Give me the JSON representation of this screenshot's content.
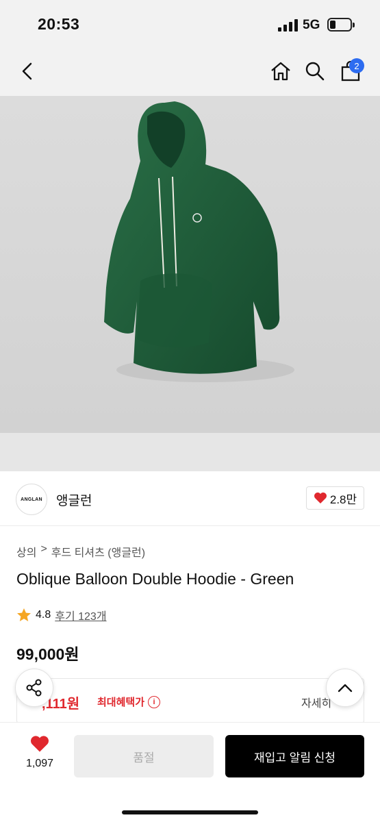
{
  "status_bar": {
    "time": "20:53",
    "network": "5G"
  },
  "nav": {
    "cart_count": "2"
  },
  "brand": {
    "logo_text": "ANGLAN",
    "name": "앵글런",
    "likes": "2.8만"
  },
  "breadcrumb": {
    "category": "상의",
    "separator": ">",
    "subcategory": "후드 티셔츠 (앵글런)"
  },
  "product": {
    "title": "Oblique Balloon Double Hoodie - Green",
    "rating": "4.8",
    "reviews": "후기 123개",
    "price": "99,000원",
    "benefit_price": ",111원",
    "benefit_label": "최대혜택가",
    "benefit_detail": "자세히"
  },
  "bottom": {
    "wish_count": "1,097",
    "soldout_label": "품절",
    "restock_label": "재입고 알림 신청"
  },
  "colors": {
    "accent_red": "#e0282e",
    "badge_blue": "#2d6cf0",
    "hoodie_green": "#1f5c3a"
  },
  "icons": [
    "back-icon",
    "home-icon",
    "search-icon",
    "cart-icon",
    "heart-icon",
    "star-icon",
    "info-icon",
    "share-icon",
    "chevron-up-icon"
  ]
}
